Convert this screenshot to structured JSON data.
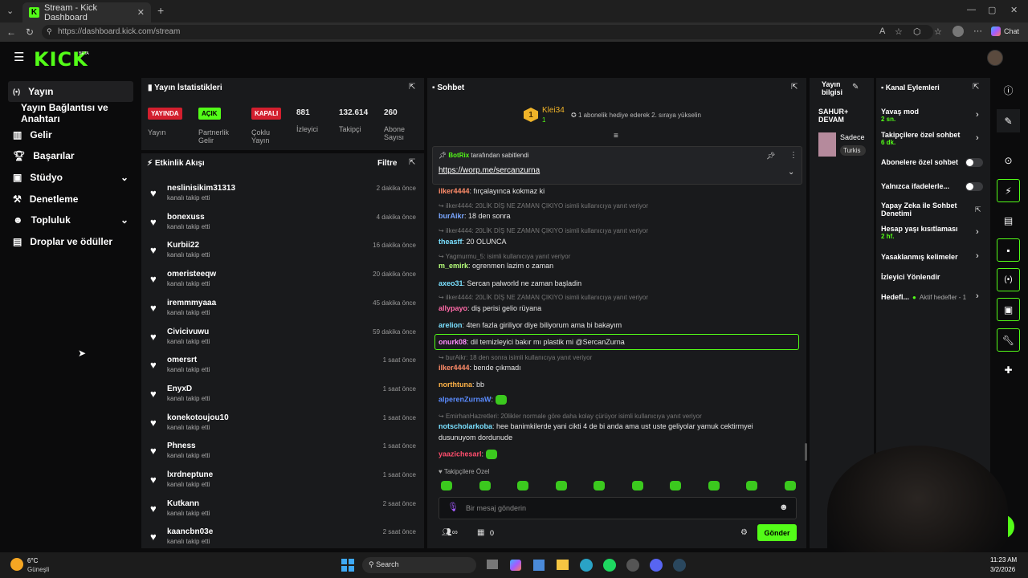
{
  "browser": {
    "tab_title": "Stream - Kick Dashboard",
    "url": "https://dashboard.kick.com/stream",
    "chat_label": "Chat"
  },
  "brand": {
    "logo": "KICK",
    "beta": "BETA",
    "accent": "#53fc18"
  },
  "sidebar": {
    "items": [
      {
        "label": "Yayın",
        "icon": "broadcast-icon"
      },
      {
        "label": "Yayın Bağlantısı ve Anahtarı",
        "icon": ""
      },
      {
        "label": "Gelir",
        "icon": "revenue-icon"
      },
      {
        "label": "Başarılar",
        "icon": "trophy-icon"
      },
      {
        "label": "Stüdyo",
        "icon": "studio-icon"
      },
      {
        "label": "Denetleme",
        "icon": "hammer-icon"
      },
      {
        "label": "Topluluk",
        "icon": "community-icon"
      },
      {
        "label": "Droplar ve ödüller",
        "icon": "drops-icon"
      }
    ]
  },
  "stats": {
    "title": "Yayın İstatistikleri",
    "items": [
      {
        "badge": "YAYINDA",
        "label": "Yayın"
      },
      {
        "badge": "AÇIK",
        "label": "Partnerlik Gelir"
      },
      {
        "badge": "KAPALI",
        "label": "Çoklu Yayın"
      },
      {
        "value": "881",
        "label": "İzleyici"
      },
      {
        "value": "132.614",
        "label": "Takipçi"
      },
      {
        "value": "260",
        "label": "Abone Sayısı"
      }
    ]
  },
  "activity": {
    "title": "Etkinlik Akışı",
    "filter": "Filtre",
    "items": [
      {
        "name": "neslinisikim31313",
        "sub": "kanalı takip etti",
        "time": "2 dakika önce"
      },
      {
        "name": "bonexuss",
        "sub": "kanalı takip etti",
        "time": "4 dakika önce"
      },
      {
        "name": "Kurbii22",
        "sub": "kanalı takip etti",
        "time": "16 dakika önce"
      },
      {
        "name": "omeristeeqw",
        "sub": "kanalı takip etti",
        "time": "20 dakika önce"
      },
      {
        "name": "iremmmyaaa",
        "sub": "kanalı takip etti",
        "time": "45 dakika önce"
      },
      {
        "name": "Civicivuwu",
        "sub": "kanalı takip etti",
        "time": "59 dakika önce"
      },
      {
        "name": "omersrt",
        "sub": "kanalı takip etti",
        "time": "1 saat önce"
      },
      {
        "name": "EnyxD",
        "sub": "kanalı takip etti",
        "time": "1 saat önce"
      },
      {
        "name": "konekotoujou10",
        "sub": "kanalı takip etti",
        "time": "1 saat önce"
      },
      {
        "name": "Phness",
        "sub": "kanalı takip etti",
        "time": "1 saat önce"
      },
      {
        "name": "lxrdneptune",
        "sub": "kanalı takip etti",
        "time": "1 saat önce"
      },
      {
        "name": "Kutkann",
        "sub": "kanalı takip etti",
        "time": "2 saat önce"
      },
      {
        "name": "kaancbn03e",
        "sub": "kanalı takip etti",
        "time": "2 saat önce"
      }
    ]
  },
  "chat": {
    "title": "Sohbet",
    "gifter": {
      "name": "Klei34",
      "count": "1",
      "rank": "1",
      "text": "1 abonelik hediye ederek 2. sıraya yükselin"
    },
    "pinned": {
      "by_user": "BotRix",
      "by_text": "tarafından sabitlendi",
      "link": "https://worp.me/sercanzurna"
    },
    "messages": [
      {
        "user": "ilker4444",
        "user_color": "#ff8c69",
        "text": ": fırçalayınca kokmaz ki"
      },
      {
        "reply": "ilker4444: 20LİK DİŞ NE ZAMAN ÇIKIYO isimli kullanıcıya yanıt veriyor"
      },
      {
        "user": "burAikr",
        "user_color": "#7aa7ff",
        "text": ": 18 den sonra"
      },
      {
        "reply": "ilker4444: 20LİK DİŞ NE ZAMAN ÇIKIYO isimli kullanıcıya yanıt veriyor"
      },
      {
        "user": "theasff",
        "user_color": "#7ae0ff",
        "text": ": 20 OLUNCA"
      },
      {
        "reply": "Yagmurmu_5: isimli kullanıcıya yanıt veriyor"
      },
      {
        "user": "m_emirk",
        "user_color": "#b6ff7a",
        "text": ": ogrenmen lazim o zaman"
      },
      {
        "user": "axeo31",
        "user_color": "#7ae0ff",
        "text": ": Sercan palworld ne zaman başladin"
      },
      {
        "reply": "ilker4444: 20LİK DİŞ NE ZAMAN ÇIKIYO isimli kullanıcıya yanıt veriyor"
      },
      {
        "user": "allypayo",
        "user_color": "#ff6aa8",
        "text": ": diş perisi gelio rüyana"
      },
      {
        "user": "arelion",
        "user_color": "#7ae0ff",
        "text": ": 4ten fazla giriliyor diye biliyorum ama bi bakayım"
      },
      {
        "user": "onurk08",
        "user_color": "#ff8cff",
        "text": ": dil temizleyici bakır mı plastik mi @SercanZurna"
      },
      {
        "reply": "burAikr: 18 den sonra isimli kullanıcıya yanıt veriyor"
      },
      {
        "user": "ilker4444",
        "user_color": "#ff8c69",
        "text": ": bende çıkmadı"
      },
      {
        "user": "northtuna",
        "user_color": "#ffb347",
        "text": ": bb"
      },
      {
        "user": "alperenZurnaW",
        "user_color": "#5b8cff",
        "text": ":"
      },
      {
        "reply": "EmirhanHazretleri: 20likler normale göre daha kolay çürüyor isimli kullanıcıya yanıt veriyor"
      },
      {
        "user": "notscholarkoba",
        "user_color": "#7ae0ff",
        "text": ": hee banimkilerde yani cikti 4 de bi anda ama ust uste geliyolar yamuk cektirmyei"
      },
      {
        "text": "dusunuyom dordunude"
      },
      {
        "user": "yaazichesarl",
        "user_color": "#ff4d6d",
        "text": ":"
      }
    ],
    "emote_bar_label": "Takipçilere Özel",
    "input_placeholder": "Bir mesaj gönderin",
    "viewer_count": "0",
    "send": "Gönder"
  },
  "stream_info": {
    "title": "Yayın bilgisi",
    "stream_title": "SAHUR+ DEVAM",
    "category": "Sadece",
    "tag": "Turkis"
  },
  "channel_actions": {
    "title": "Kanal Eylemleri",
    "items": [
      {
        "label": "Yavaş mod",
        "sub": "2 sn."
      },
      {
        "label": "Takipçilere özel sohbet",
        "sub": "6 dk."
      },
      {
        "label": "Abonelere özel sohbet",
        "sub": ""
      },
      {
        "label": "Yalnızca ifadelerle...",
        "sub": ""
      },
      {
        "label": "Yapay Zeka ile Sohbet Denetimi",
        "sub": ""
      },
      {
        "label": "Hesap yaşı kısıtlaması",
        "sub": "2 hf."
      },
      {
        "label": "Yasaklanmış kelimeler",
        "sub": ""
      },
      {
        "label": "İzleyici Yönlendir",
        "sub": ""
      },
      {
        "label": "Hedefl...",
        "sub": "Aktif hedefler - 1"
      }
    ]
  },
  "taskbar": {
    "weather_temp": "6°C",
    "weather_label": "Güneşli",
    "search": "Search",
    "time": "11:23 AM",
    "date": "3/2/2026"
  }
}
